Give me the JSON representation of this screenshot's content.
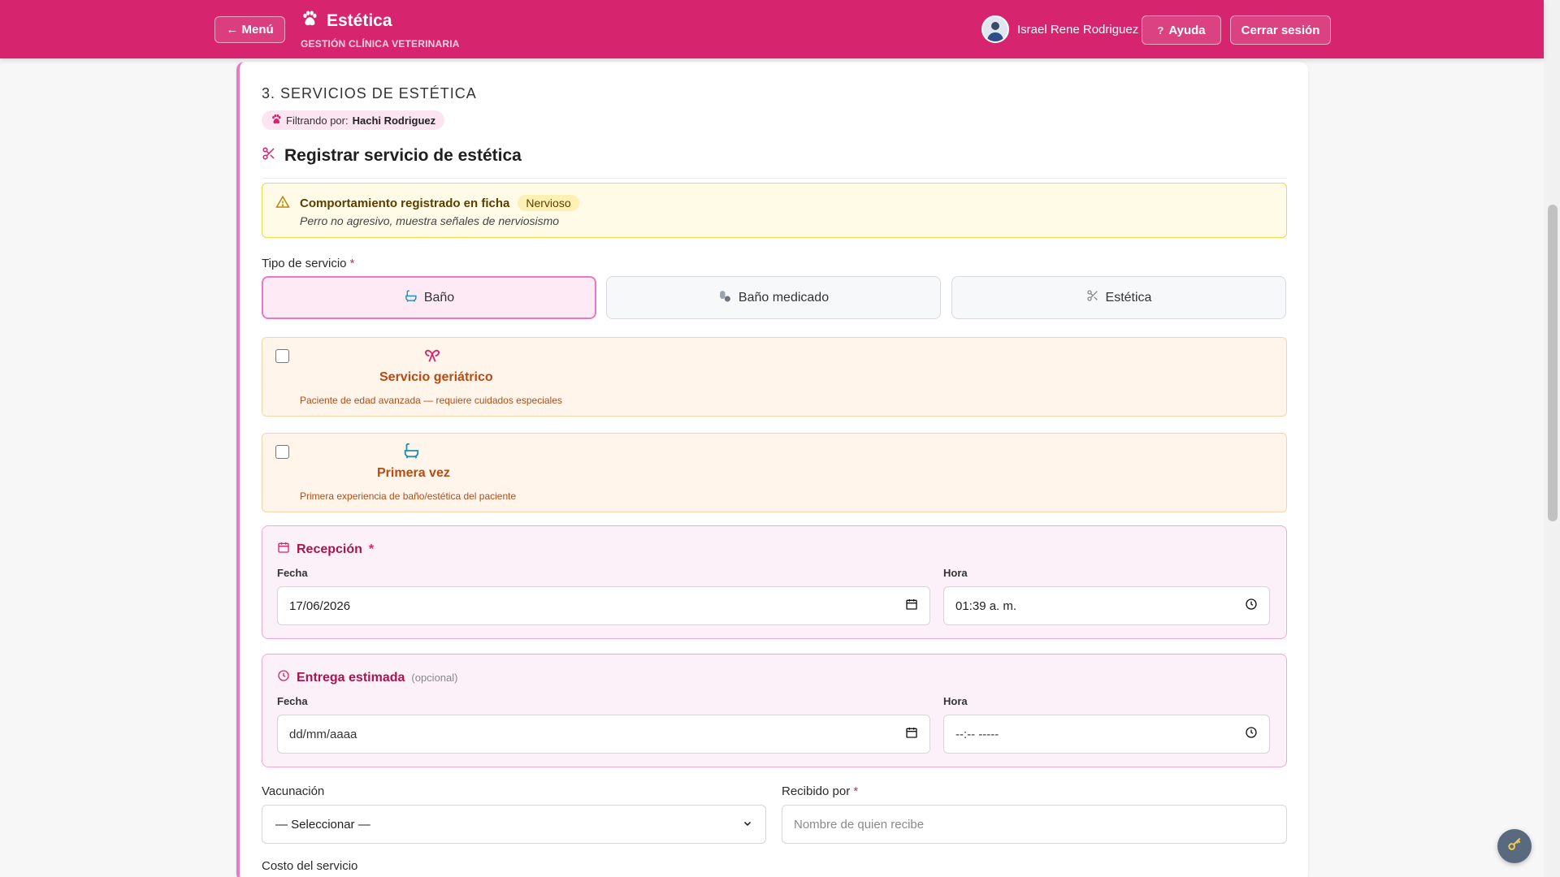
{
  "header": {
    "menu_label": "← Menú",
    "title": "Estética",
    "subtitle": "GESTIÓN CLÍNICA VETERINARIA",
    "user_name": "Israel Rene Rodriguez",
    "help_label": "Ayuda",
    "logout_label": "Cerrar sesión",
    "brand_color": "#d6246e"
  },
  "section": {
    "title": "3. SERVICIOS DE ESTÉTICA",
    "filter_prefix": "Filtrando por:",
    "filter_value": "Hachi Rodriguez",
    "form_title": "Registrar servicio de estética"
  },
  "alert": {
    "title": "Comportamiento registrado en ficha",
    "badge": "Nervioso",
    "text": "Perro no agresivo, muestra señales de nerviosismo"
  },
  "service_type": {
    "label": "Tipo de servicio",
    "required_mark": "*",
    "options": [
      {
        "label": "Baño",
        "icon": "bathtub-icon",
        "selected": true
      },
      {
        "label": "Baño medicado",
        "icon": "pills-icon",
        "selected": false
      },
      {
        "label": "Estética",
        "icon": "scissors-icon",
        "selected": false
      }
    ]
  },
  "geriatric": {
    "title": "Servicio geriátrico",
    "desc": "Paciente de edad avanzada — requiere cuidados especiales",
    "checked": false
  },
  "first_time": {
    "title": "Primera vez",
    "desc": "Primera experiencia de baño/estética del paciente",
    "checked": false
  },
  "reception": {
    "title": "Recepción",
    "required_mark": "*",
    "date_label": "Fecha",
    "date_value": "17/06/2026",
    "time_label": "Hora",
    "time_value": "01:39 a. m."
  },
  "delivery": {
    "title": "Entrega estimada",
    "optional": "(opcional)",
    "date_label": "Fecha",
    "date_placeholder": "dd/mm/aaaa",
    "time_label": "Hora",
    "time_placeholder": "--:-- -----"
  },
  "vaccination": {
    "label": "Vacunación",
    "selected": "— Seleccionar —"
  },
  "received_by": {
    "label": "Recibido por",
    "required_mark": "*",
    "placeholder": "Nombre de quien recibe"
  },
  "cost": {
    "label": "Costo del servicio"
  }
}
